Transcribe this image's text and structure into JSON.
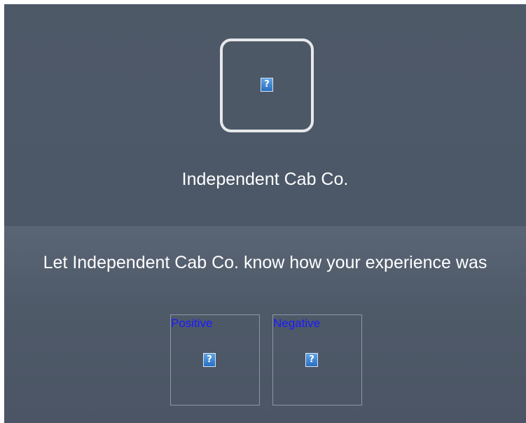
{
  "company": {
    "logo_icon": "broken-image-icon",
    "name": "Independent Cab Co."
  },
  "feedback": {
    "prompt": "Let Independent Cab Co. know how your experience was",
    "options": [
      {
        "label": "Positive",
        "icon": "broken-image-icon"
      },
      {
        "label": "Negative",
        "icon": "broken-image-icon"
      }
    ]
  },
  "broken_image_glyph": "?",
  "colors": {
    "background": "#4d5867",
    "text": "#ffffff",
    "link": "#1a1aff",
    "logo_border": "#e6e8ea"
  }
}
